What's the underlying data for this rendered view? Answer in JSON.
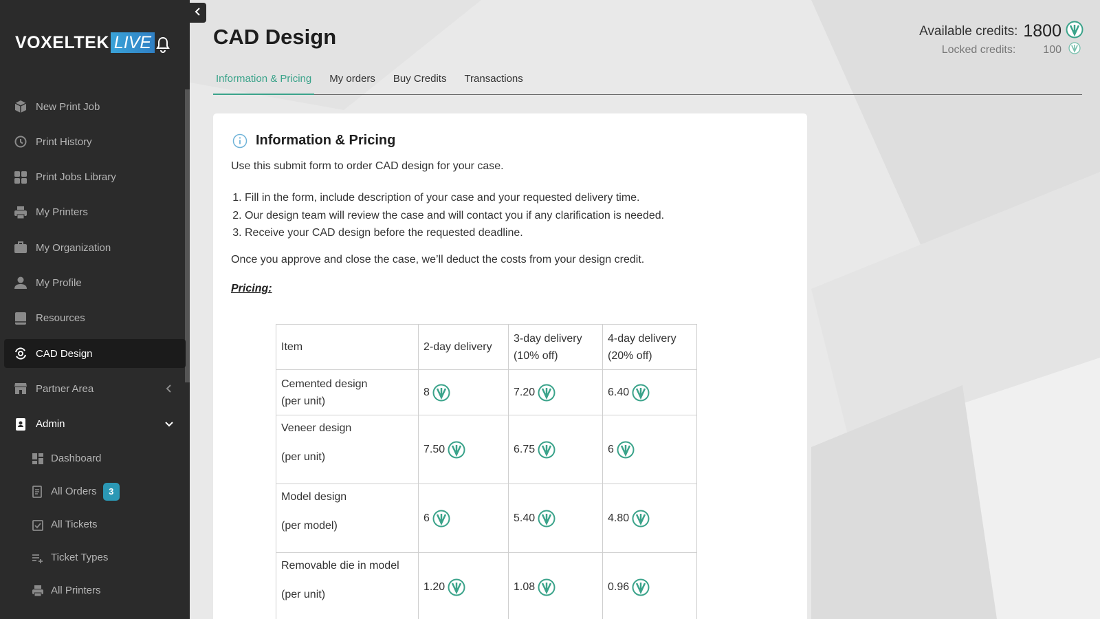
{
  "app": {
    "brand_name": "VOXELTEK",
    "brand_suffix": "LIVE",
    "accent_color": "#3aa38a"
  },
  "sidebar": {
    "items": [
      {
        "label": "New Print Job",
        "icon": "box-icon"
      },
      {
        "label": "Print History",
        "icon": "history-icon"
      },
      {
        "label": "Print Jobs Library",
        "icon": "grid-icon"
      },
      {
        "label": "My Printers",
        "icon": "printer-icon"
      },
      {
        "label": "My Organization",
        "icon": "briefcase-icon"
      },
      {
        "label": "My Profile",
        "icon": "user-icon"
      },
      {
        "label": "Resources",
        "icon": "book-icon"
      },
      {
        "label": "CAD Design",
        "icon": "cad-icon",
        "active": true
      },
      {
        "label": "Partner Area",
        "icon": "store-icon"
      },
      {
        "label": "Admin",
        "icon": "id-card-icon"
      }
    ],
    "admin_items": [
      {
        "label": "Dashboard",
        "icon": "dashboard-icon"
      },
      {
        "label": "All Orders",
        "icon": "orders-icon",
        "badge": "3"
      },
      {
        "label": "All Tickets",
        "icon": "ticket-icon"
      },
      {
        "label": "Ticket Types",
        "icon": "list-icon"
      },
      {
        "label": "All Printers",
        "icon": "printer-icon"
      }
    ]
  },
  "header": {
    "title": "CAD Design",
    "available_label": "Available credits:",
    "available_value": "1800",
    "locked_label": "Locked credits:",
    "locked_value": "100"
  },
  "tabs": [
    {
      "label": "Information & Pricing",
      "active": true
    },
    {
      "label": "My orders"
    },
    {
      "label": "Buy Credits"
    },
    {
      "label": "Transactions"
    }
  ],
  "card": {
    "title": "Information & Pricing",
    "intro": "Use this submit form to order CAD design for your case.",
    "steps": [
      "Fill in the form, include description of your case and your requested delivery time.",
      "Our design team will review the case and will contact you if any clarification is needed.",
      "Receive your CAD design before the requested deadline."
    ],
    "outro": "Once you approve and close the case, we’ll deduct the costs from your design credit.",
    "pricing_label": "Pricing:"
  },
  "pricing_table": {
    "header": {
      "item": "Item",
      "col1": "2-day delivery",
      "col2_line1": "3-day delivery",
      "col2_line2": "(10% off)",
      "col3_line1": "4-day delivery",
      "col3_line2": "(20% off)"
    },
    "rows": [
      {
        "name": "Cemented design",
        "unit": "(per unit)",
        "v1": "8",
        "v2": "7.20",
        "v3": "6.40"
      },
      {
        "name": "Veneer design",
        "unit": "(per unit)",
        "v1": "7.50",
        "v2": "6.75",
        "v3": "6"
      },
      {
        "name": "Model design",
        "unit": "(per model)",
        "v1": "6",
        "v2": "5.40",
        "v3": "4.80"
      },
      {
        "name": "Removable die in model",
        "unit": "(per unit)",
        "v1": "1.20",
        "v2": "1.08",
        "v3": "0.96"
      }
    ]
  }
}
